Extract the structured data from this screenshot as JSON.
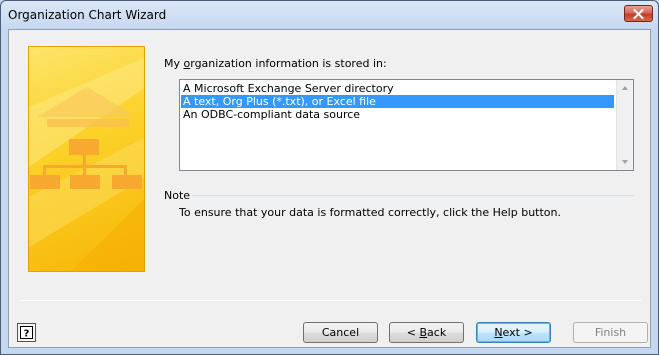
{
  "window": {
    "title": "Organization Chart Wizard"
  },
  "prompt": {
    "label_pre": "My ",
    "label_mnemonic": "o",
    "label_post": "rganization information is stored in:"
  },
  "listbox": {
    "items": [
      {
        "label": "A Microsoft Exchange Server directory",
        "selected": false
      },
      {
        "label": "A text, Org Plus (*.txt), or Excel file",
        "selected": true
      },
      {
        "label": "An ODBC-compliant data source",
        "selected": false
      }
    ]
  },
  "note": {
    "heading": "Note",
    "text": "To ensure that your data is formatted correctly, click the Help button."
  },
  "buttons": {
    "help_icon": "question-mark-icon",
    "cancel": "Cancel",
    "back_mnemonic": "B",
    "back_rest": "ack",
    "back_prefix": "< ",
    "next_mnemonic": "N",
    "next_rest": "ext >",
    "finish": "Finish"
  },
  "colors": {
    "selection": "#3399ff",
    "art_yellow": "#fcd22a",
    "close_red": "#c43c2b"
  }
}
